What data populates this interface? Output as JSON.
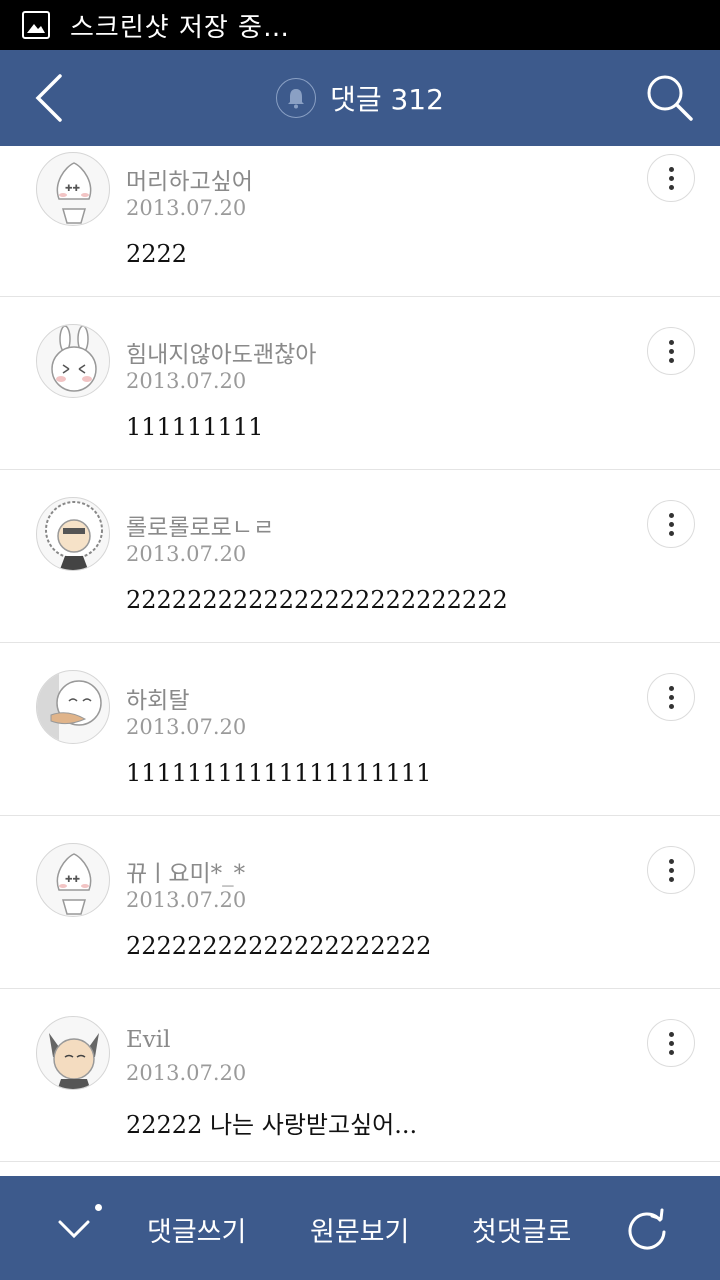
{
  "status_bar": {
    "text": "스크린샷 저장 중…"
  },
  "header": {
    "title": "댓글 312"
  },
  "comments": [
    {
      "author": "머리하고싶어",
      "date": "2013.07.20",
      "text": "2222"
    },
    {
      "author": "힘내지않아도괜찮아",
      "date": "2013.07.20",
      "text": "111111111"
    },
    {
      "author": "롤로롤로로ㄴㄹ",
      "date": "2013.07.20",
      "text": "2222222222222222222222222"
    },
    {
      "author": "하회탈",
      "date": "2013.07.20",
      "text": "11111111111111111111"
    },
    {
      "author": "뀨ㅣ요미*_*",
      "date": "2013.07.20",
      "text": "22222222222222222222"
    },
    {
      "author": "Evil",
      "date": "2013.07.20",
      "text": "22222 나는 사랑받고싶어..."
    }
  ],
  "bottom_bar": {
    "write_label": "댓글쓰기",
    "original_label": "원문보기",
    "first_label": "첫댓글로"
  }
}
